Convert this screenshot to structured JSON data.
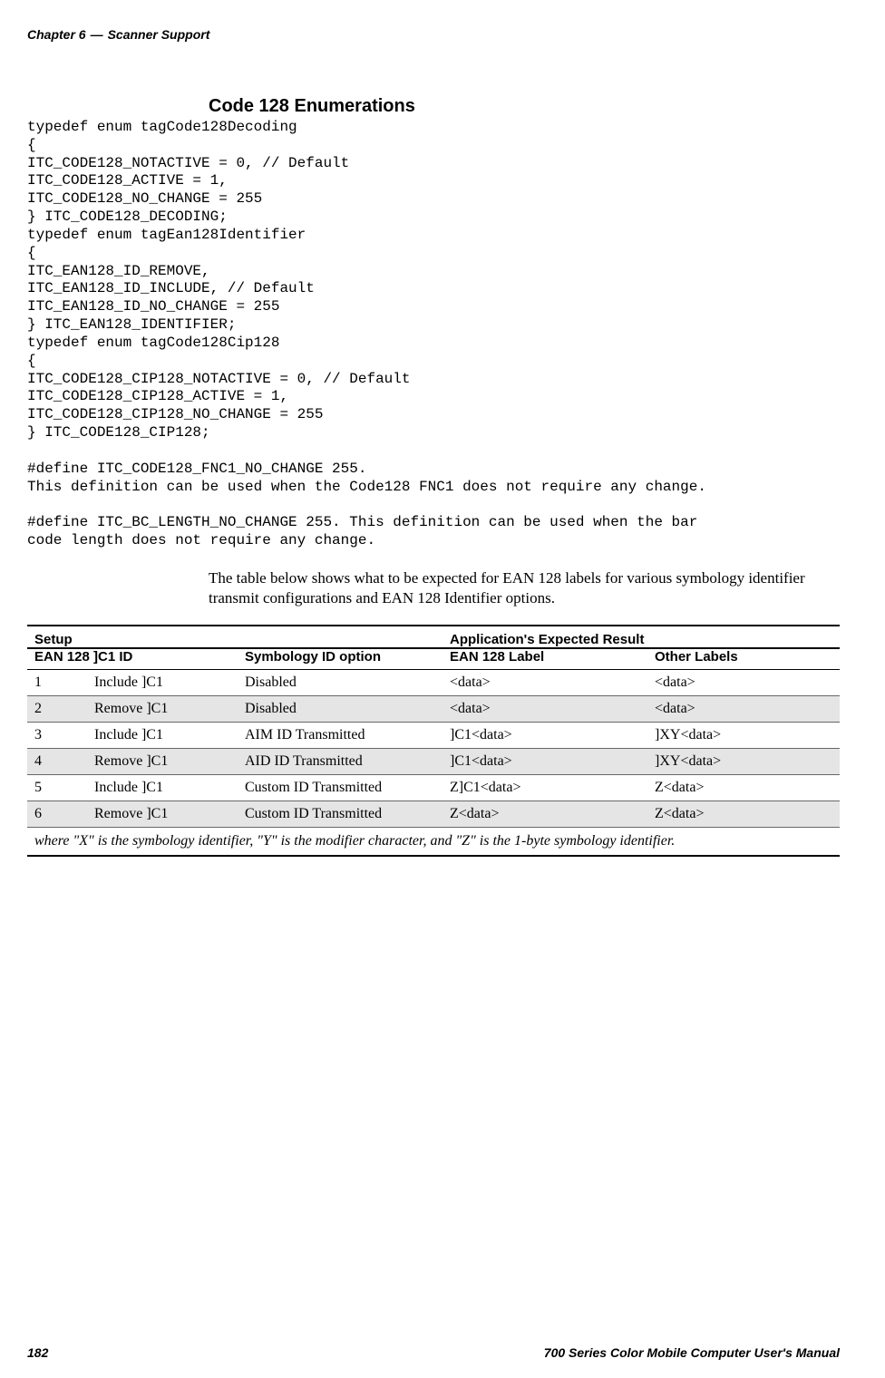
{
  "header": {
    "chapter": "Chapter 6",
    "section": "Scanner Support"
  },
  "heading": "Code 128 Enumerations",
  "code": "typedef enum tagCode128Decoding\n{\nITC_CODE128_NOTACTIVE = 0, // Default\nITC_CODE128_ACTIVE = 1,\nITC_CODE128_NO_CHANGE = 255\n} ITC_CODE128_DECODING;\ntypedef enum tagEan128Identifier\n{\nITC_EAN128_ID_REMOVE,\nITC_EAN128_ID_INCLUDE, // Default\nITC_EAN128_ID_NO_CHANGE = 255\n} ITC_EAN128_IDENTIFIER;\ntypedef enum tagCode128Cip128\n{\nITC_CODE128_CIP128_NOTACTIVE = 0, // Default\nITC_CODE128_CIP128_ACTIVE = 1,\nITC_CODE128_CIP128_NO_CHANGE = 255\n} ITC_CODE128_CIP128;\n\n#define ITC_CODE128_FNC1_NO_CHANGE 255.\nThis definition can be used when the Code128 FNC1 does not require any change.\n\n#define ITC_BC_LENGTH_NO_CHANGE 255. This definition can be used when the bar\ncode length does not require any change.",
  "body": "The table below shows what to be expected for EAN 128 labels for various symbology identifier transmit configurations and EAN 128 Identifier options.",
  "table": {
    "header_group_1": "Setup",
    "header_group_2": "Application's Expected Result",
    "header_col_1": "EAN 128 ]C1 ID",
    "header_col_2": "Symbology ID option",
    "header_col_3": "EAN 128 Label",
    "header_col_4": "Other Labels",
    "rows": [
      {
        "n": "1",
        "ean": "Include ]C1",
        "sym": "Disabled",
        "label": "<data>",
        "other": "<data>"
      },
      {
        "n": "2",
        "ean": "Remove ]C1",
        "sym": "Disabled",
        "label": "<data>",
        "other": "<data>"
      },
      {
        "n": "3",
        "ean": "Include ]C1",
        "sym": "AIM ID Transmitted",
        "label": "]C1<data>",
        "other": "]XY<data>"
      },
      {
        "n": "4",
        "ean": "Remove ]C1",
        "sym": "AID ID Transmitted",
        "label": "]C1<data>",
        "other": "]XY<data>"
      },
      {
        "n": "5",
        "ean": "Include ]C1",
        "sym": "Custom ID Transmitted",
        "label": "Z]C1<data>",
        "other": "Z<data>"
      },
      {
        "n": "6",
        "ean": "Remove ]C1",
        "sym": "Custom ID Transmitted",
        "label": "Z<data>",
        "other": "Z<data>"
      }
    ],
    "footnote": "where \"X\" is the symbology identifier, \"Y\" is the modifier character, and \"Z\" is the 1-byte symbology identifier."
  },
  "footer": {
    "page": "182",
    "title": "700 Series Color Mobile Computer User's Manual"
  }
}
